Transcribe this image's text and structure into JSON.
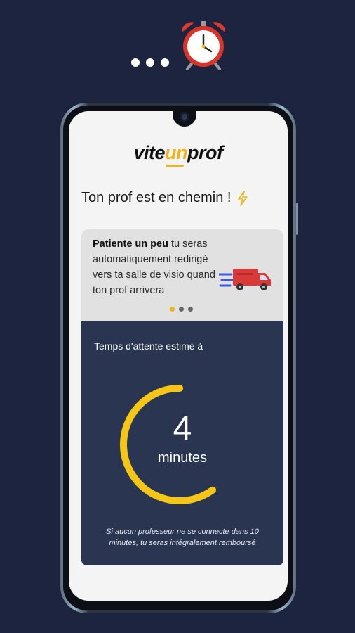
{
  "brand": {
    "logo_part1": "vite",
    "logo_part2": "un",
    "logo_part3": "prof",
    "accent_color": "#f2b417",
    "background_color": "#1c2440"
  },
  "header": {
    "title": "Ton prof est en chemin !",
    "emoji_icon": "lightning-icon"
  },
  "decor": {
    "top_icons": [
      "dots-icon",
      "alarm-clock-icon"
    ]
  },
  "info_card": {
    "bold_text": "Patiente un peu",
    "rest_text": " tu seras automatiquement redirigé vers ta salle de visio quand ton prof arrivera",
    "illustration": "delivery-truck-icon",
    "pager": {
      "count": 3,
      "active_index": 0
    }
  },
  "timer": {
    "label": "Temps d'attente estimé à",
    "value": "4",
    "unit": "minutes",
    "progress": 0.6,
    "ring_color": "#f5c518",
    "refund_note": "Si aucun professeur ne se connecte dans 10 minutes, tu seras intégralement remboursé"
  }
}
